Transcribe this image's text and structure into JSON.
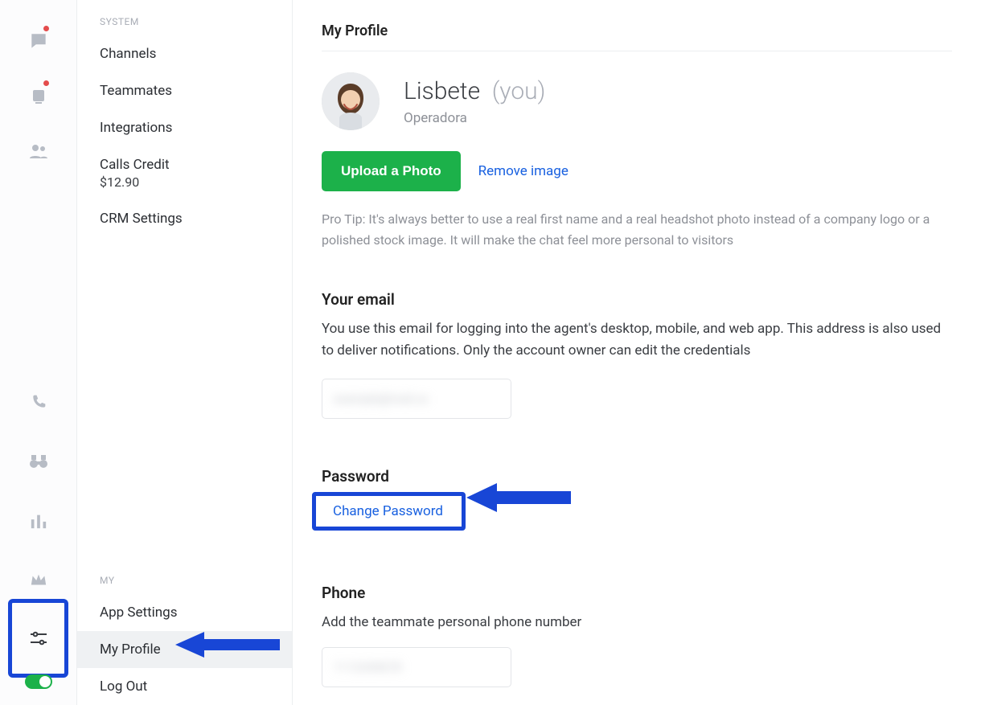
{
  "iconrail": {
    "items": [
      {
        "name": "chat-icon",
        "dot": true
      },
      {
        "name": "contact-icon",
        "dot": true
      },
      {
        "name": "people-icon",
        "dot": false
      }
    ],
    "lower": [
      {
        "name": "phone-icon"
      },
      {
        "name": "binoculars-icon"
      },
      {
        "name": "stats-icon"
      },
      {
        "name": "crown-icon"
      }
    ],
    "settings_name": "settings-icon",
    "status_on": true
  },
  "sidebar": {
    "system_label": "SYSTEM",
    "system_items": [
      {
        "label": "Channels"
      },
      {
        "label": "Teammates"
      },
      {
        "label": "Integrations"
      },
      {
        "label": "Calls Credit",
        "sub": "$12.90"
      },
      {
        "label": "CRM Settings"
      }
    ],
    "my_label": "MY",
    "my_items": [
      {
        "label": "App Settings"
      },
      {
        "label": "My Profile",
        "active": true
      },
      {
        "label": "Log Out"
      }
    ]
  },
  "profile": {
    "page_title": "My Profile",
    "name": "Lisbete",
    "you": "(you)",
    "role": "Operadora",
    "upload_label": "Upload a Photo",
    "remove_label": "Remove image",
    "tip": "Pro Tip: It's always better to use a real first name and a real headshot photo instead of a company logo or a polished stock image. It will make the chat feel more personal to visitors",
    "email_title": "Your email",
    "email_desc": "You use this email for logging into the agent's desktop, mobile, and web app. This address is also used to deliver notifications. Only the account owner can edit the credentials",
    "email_value": "example@mail.xx",
    "password_title": "Password",
    "change_password": "Change Password",
    "phone_title": "Phone",
    "phone_desc": "Add the teammate personal phone number",
    "phone_value": "1112345678"
  }
}
